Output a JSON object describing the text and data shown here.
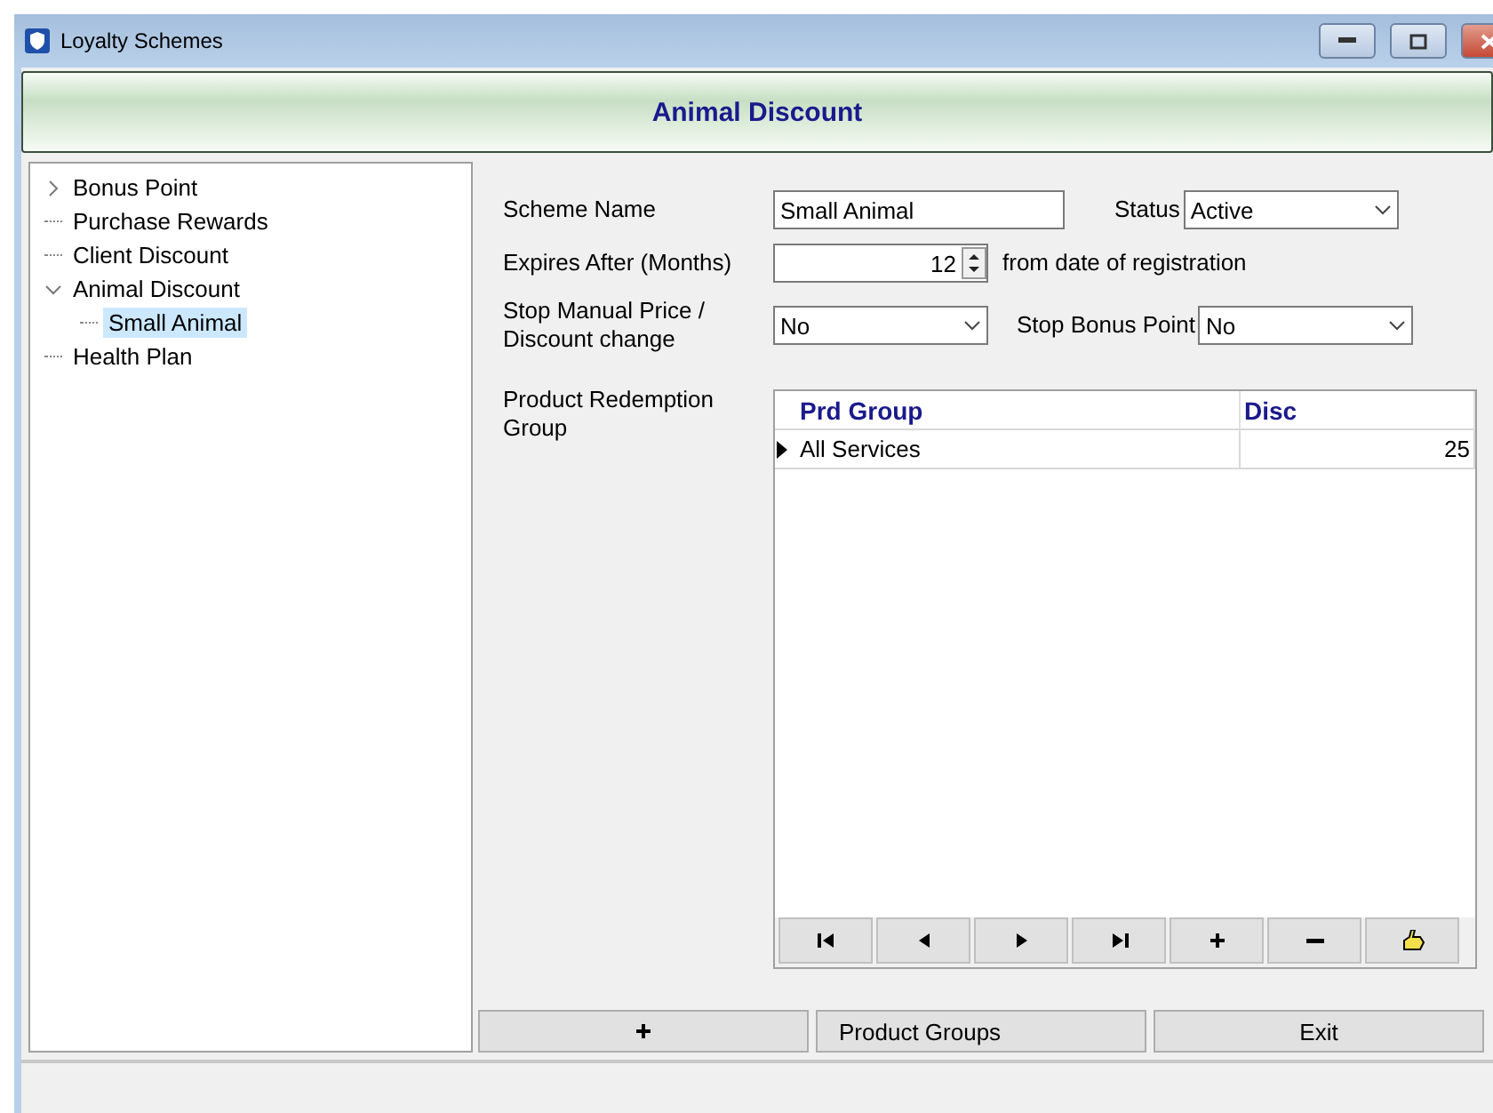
{
  "window": {
    "title": "Loyalty Schemes"
  },
  "header": {
    "title": "Animal Discount"
  },
  "tree": [
    {
      "label": "Bonus Point",
      "expanded": false,
      "selected": false
    },
    {
      "label": "Purchase Rewards",
      "selected": false
    },
    {
      "label": "Client Discount",
      "selected": false
    },
    {
      "label": "Animal Discount",
      "expanded": true,
      "selected": false,
      "children": [
        {
          "label": "Small Animal",
          "selected": true
        }
      ]
    },
    {
      "label": "Health Plan",
      "selected": false
    }
  ],
  "form": {
    "scheme_name": {
      "label": "Scheme Name",
      "value": "Small Animal"
    },
    "status": {
      "label": "Status",
      "value": "Active"
    },
    "expires": {
      "label": "Expires After (Months)",
      "value": "12",
      "suffix": "from date of registration"
    },
    "stop_manual": {
      "label": "Stop Manual Price / Discount change",
      "value": "No"
    },
    "stop_bonus": {
      "label": "Stop Bonus Point",
      "value": "No"
    },
    "redemption": {
      "label": "Product Redemption Group",
      "columns": [
        "Prd Group",
        "Disc"
      ],
      "rows": [
        {
          "cells": [
            "All Services",
            "25"
          ],
          "current": true
        }
      ]
    }
  },
  "nav_buttons": [
    {
      "kind": "first"
    },
    {
      "kind": "prev"
    },
    {
      "kind": "next"
    },
    {
      "kind": "last"
    },
    {
      "kind": "add"
    },
    {
      "kind": "delete"
    },
    {
      "kind": "edit"
    }
  ],
  "footer_buttons": [
    {
      "kind": "add"
    },
    {
      "kind": "text_left",
      "label": "Product Groups"
    },
    {
      "kind": "text",
      "label": "Exit"
    }
  ]
}
